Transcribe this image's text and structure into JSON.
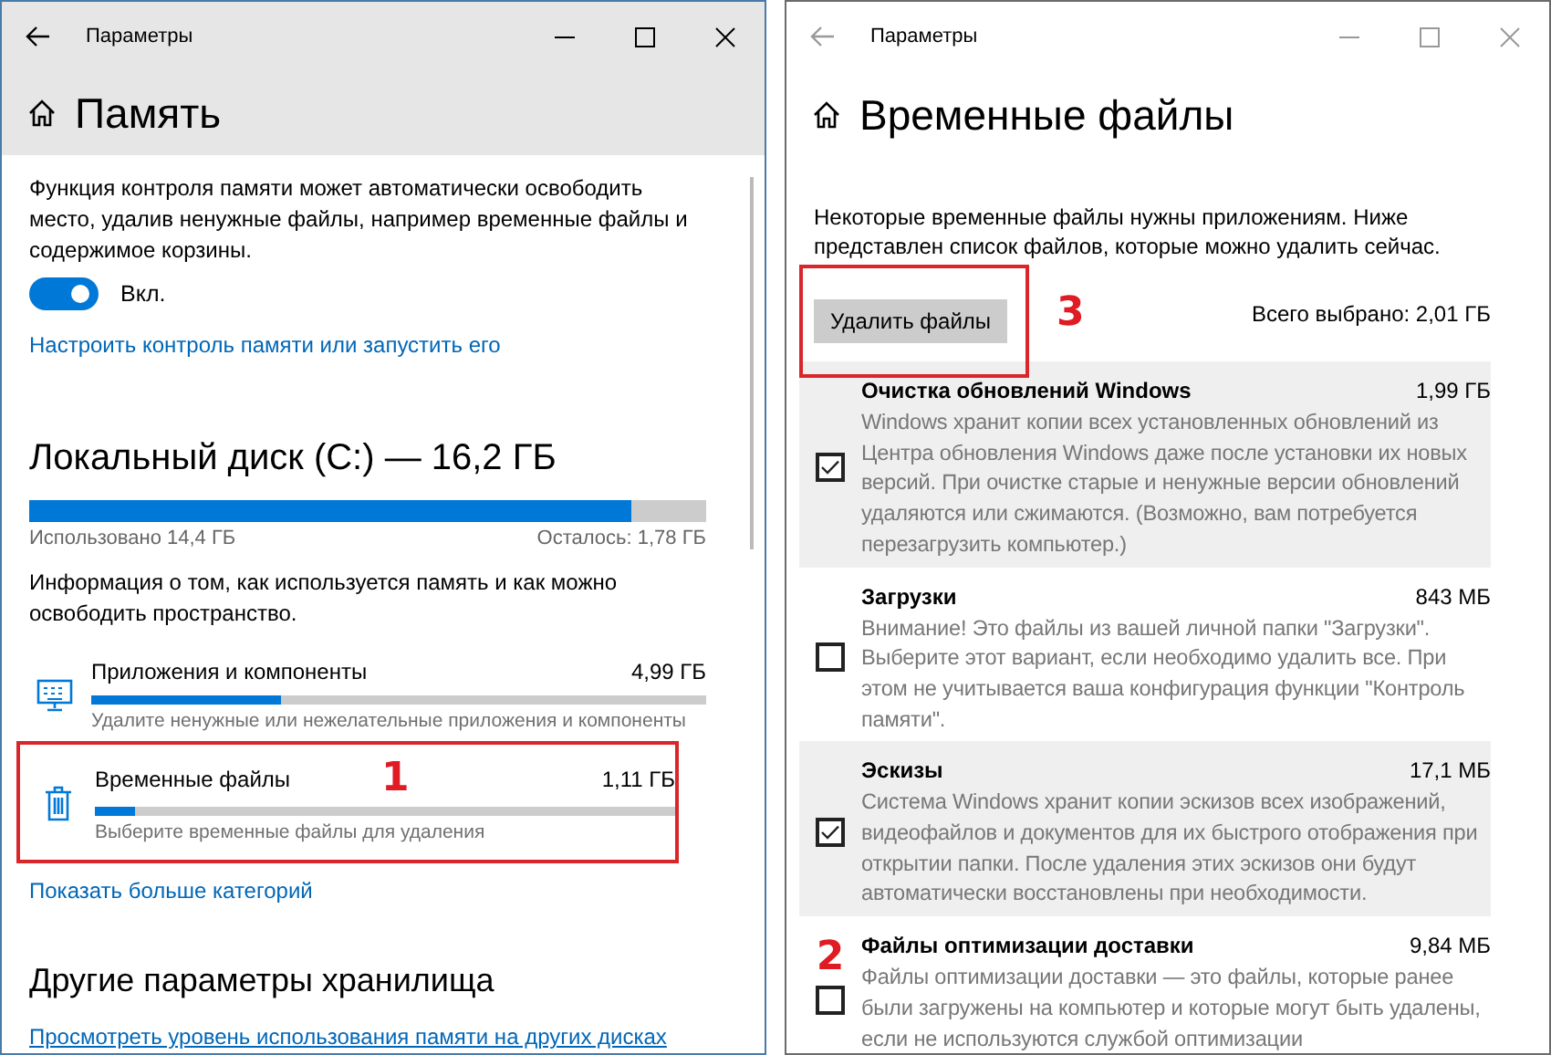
{
  "left_window": {
    "title": "Параметры",
    "active": true,
    "heading": "Память",
    "description": "Функция контроля памяти может автоматически освободить место, удалив ненужные файлы, например временные файлы и содержимое корзины.",
    "toggle": {
      "on": true,
      "label": "Вкл."
    },
    "configure_link": "Настроить контроль памяти или запустить его",
    "disk": {
      "title": "Локальный диск (C:) — 16,2 ГБ",
      "level": 0.89,
      "used": "Использовано 14,4 ГБ",
      "free": "Осталось: 1,78 ГБ"
    },
    "info": "Информация о том, как используется память и как можно освободить пространство.",
    "categories": [
      {
        "kind": "apps",
        "name": "Приложения и компоненты",
        "size": "4,99 ГБ",
        "level": 0.31,
        "description": "Удалите ненужные или нежелательные приложения и компоненты"
      },
      {
        "kind": "temp",
        "name": "Временные файлы",
        "size": "1,11 ГБ",
        "level": 0.07,
        "description": "Выберите временные файлы для удаления",
        "annotation": {
          "number": "1",
          "boxed": true
        }
      }
    ],
    "more_link": "Показать больше категорий",
    "section_title": "Другие параметры хранилища",
    "section_link": "Просмотреть уровень использования памяти на других дисках"
  },
  "right_window": {
    "title": "Параметры",
    "active": false,
    "heading": "Временные файлы",
    "description": "Некоторые временные файлы нужны приложениям. Ниже представлен список файлов, которые можно удалить сейчас.",
    "delete_button": {
      "label": "Удалить файлы",
      "annotation": {
        "number": "3",
        "boxed": true
      }
    },
    "total": "Всего выбрано: 2,01 ГБ",
    "files": [
      {
        "name": "Очистка обновлений Windows",
        "size": "1,99 ГБ",
        "checked": true,
        "description": "Windows хранит копии всех установленных обновлений из Центра обновления Windows даже после установки их новых версий. При очистке старые и ненужные версии обновлений удаляются или сжимаются. (Возможно, вам потребуется перезагрузить компьютер.)"
      },
      {
        "name": "Загрузки",
        "size": "843 МБ",
        "checked": false,
        "description": "Внимание! Это файлы из вашей личной папки \"Загрузки\". Выберите этот вариант, если необходимо удалить все. При этом не учитывается ваша конфигурация функции \"Контроль памяти\"."
      },
      {
        "name": "Эскизы",
        "size": "17,1 МБ",
        "checked": true,
        "description": "Система Windows хранит копии эскизов всех изображений, видеофайлов и документов для их быстрого отображения при открытии папки. После удаления этих эскизов они будут автоматически восстановлены при необходимости."
      },
      {
        "name": "Файлы оптимизации доставки",
        "size": "9,84 МБ",
        "checked": false,
        "description": "Файлы оптимизации доставки — это файлы, которые ранее были загружены на компьютер и которые могут быть удалены, если не используются службой оптимизации",
        "annotation": {
          "number": "2",
          "boxed": false
        }
      }
    ]
  }
}
